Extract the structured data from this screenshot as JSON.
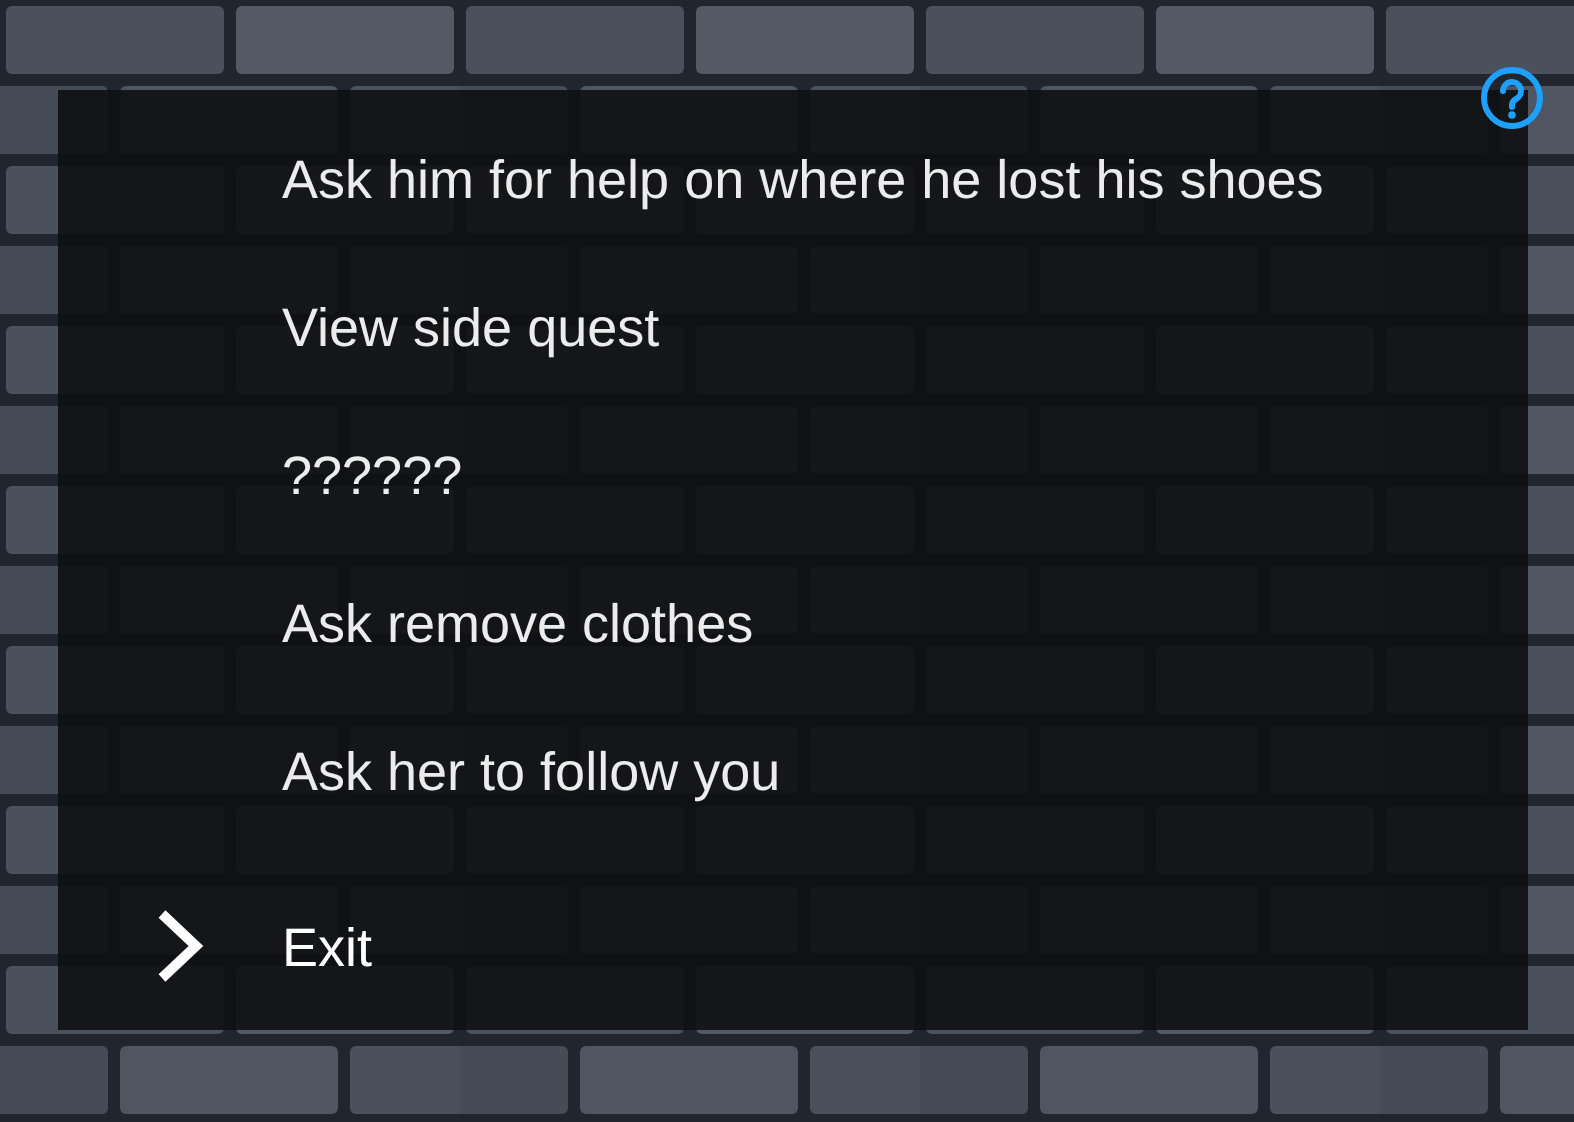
{
  "dialogue_menu": {
    "options": [
      {
        "label": "Ask him for help on where he lost his shoes",
        "selected": false
      },
      {
        "label": "View side quest",
        "selected": false
      },
      {
        "label": "??????",
        "selected": false
      },
      {
        "label": "Ask remove clothes",
        "selected": false
      },
      {
        "label": "Ask her to follow you",
        "selected": false
      },
      {
        "label": "Exit",
        "selected": true
      }
    ]
  }
}
